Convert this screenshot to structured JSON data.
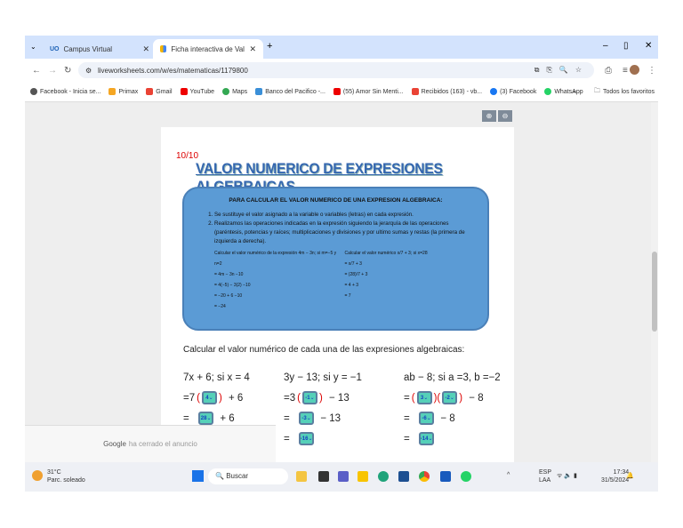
{
  "tabs": [
    {
      "label": "Campus Virtual"
    },
    {
      "label": "Ficha interactiva de Valor numé"
    }
  ],
  "address": {
    "url": "liveworksheets.com/w/es/matematicas/1179800"
  },
  "bookmarks": [
    "Facebook - Inicia se...",
    "Primax",
    "Gmail",
    "YouTube",
    "Maps",
    "Banco del Pacifico -...",
    "(55) Amor Sin Menti...",
    "Recibidos (163) - vb...",
    "(3) Facebook",
    "WhatsApp"
  ],
  "bookmarks_all": "Todos los favoritos",
  "worksheet": {
    "score": "10/10",
    "title": "VALOR NUMERICO DE EXPRESIONES ALGEBRAICAS",
    "box_heading": "PARA CALCULAR EL VALOR NUMERICO DE UNA EXPRESION ALGEBRAICA:",
    "steps": [
      "Se sustituye el valor asignado a la variable o variables (letras) en cada expresión.",
      "Realizamos las operaciones indicadas en la expresión siguiendo la jerarquía de las operaciones (paréntesis, potencias y raíces; multiplicaciones y divisiones y por ultimo sumas y restas (la primera de izquierda a derecha)."
    ],
    "example1": {
      "title": "Calcular el valor numérico de la expresión 4m − 3n; si m=−5 y n=2",
      "lines": [
        "= 4m − 3n −10",
        "= 4(−5) − 3(2) −10",
        "= −20 + 6 −10",
        "= −24"
      ]
    },
    "example2": {
      "title": "Calcular el valor numérico x/7 + 3; si x=28",
      "lines": [
        "= x/7 + 3",
        "= (28)/7 + 3",
        "= 4 + 3",
        "= 7"
      ]
    },
    "instruction": "Calcular el valor numérico de cada una de las expresiones algebraicas:",
    "problems": [
      {
        "expr": "7x + 6; si x = 4",
        "row1_pre": "=7",
        "row1_vals": [
          "4"
        ],
        "row1_post": "+ 6",
        "row2_val": "28",
        "row2_post": "+ 6"
      },
      {
        "expr": "3y − 13; si y = −1",
        "row1_pre": "=3",
        "row1_vals": [
          "-1"
        ],
        "row1_post": "− 13",
        "row2_val": "-3",
        "row2_post": "− 13",
        "row3_val": "-16"
      },
      {
        "expr": "ab − 8; si a =3, b =−2",
        "row1_pre": "=",
        "row1_vals": [
          "3",
          "-2"
        ],
        "row1_post": "− 8",
        "row2_val": "-6",
        "row2_post": "− 8",
        "row3_val": "-14"
      }
    ],
    "equals": "="
  },
  "ad": {
    "brand": "Google",
    "text": "ha cerrado el anuncio"
  },
  "taskbar": {
    "temp": "31°C",
    "weather": "Parc. soleado",
    "search": "Buscar",
    "lang1": "ESP",
    "lang2": "LAA",
    "time": "17:34",
    "date": "31/5/2024"
  }
}
